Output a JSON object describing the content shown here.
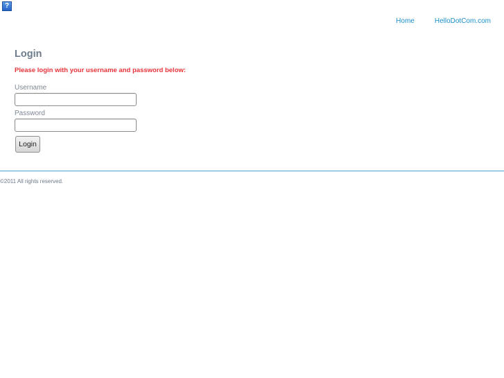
{
  "help": {
    "glyph": "?"
  },
  "nav": {
    "items": [
      {
        "label": "Home"
      },
      {
        "label": "HelloDotCom.com"
      }
    ]
  },
  "login": {
    "title": "Login",
    "message": "Please login with your username and password below:",
    "username_label": "Username",
    "username_value": "",
    "password_label": "Password",
    "password_value": "",
    "button_label": "Login"
  },
  "footer": {
    "text": "©2011 All rights reserved."
  },
  "colors": {
    "link": "#1a8fc9",
    "message": "#e8343a",
    "title": "#6d7b8a",
    "divider": "#4aa3cc"
  }
}
